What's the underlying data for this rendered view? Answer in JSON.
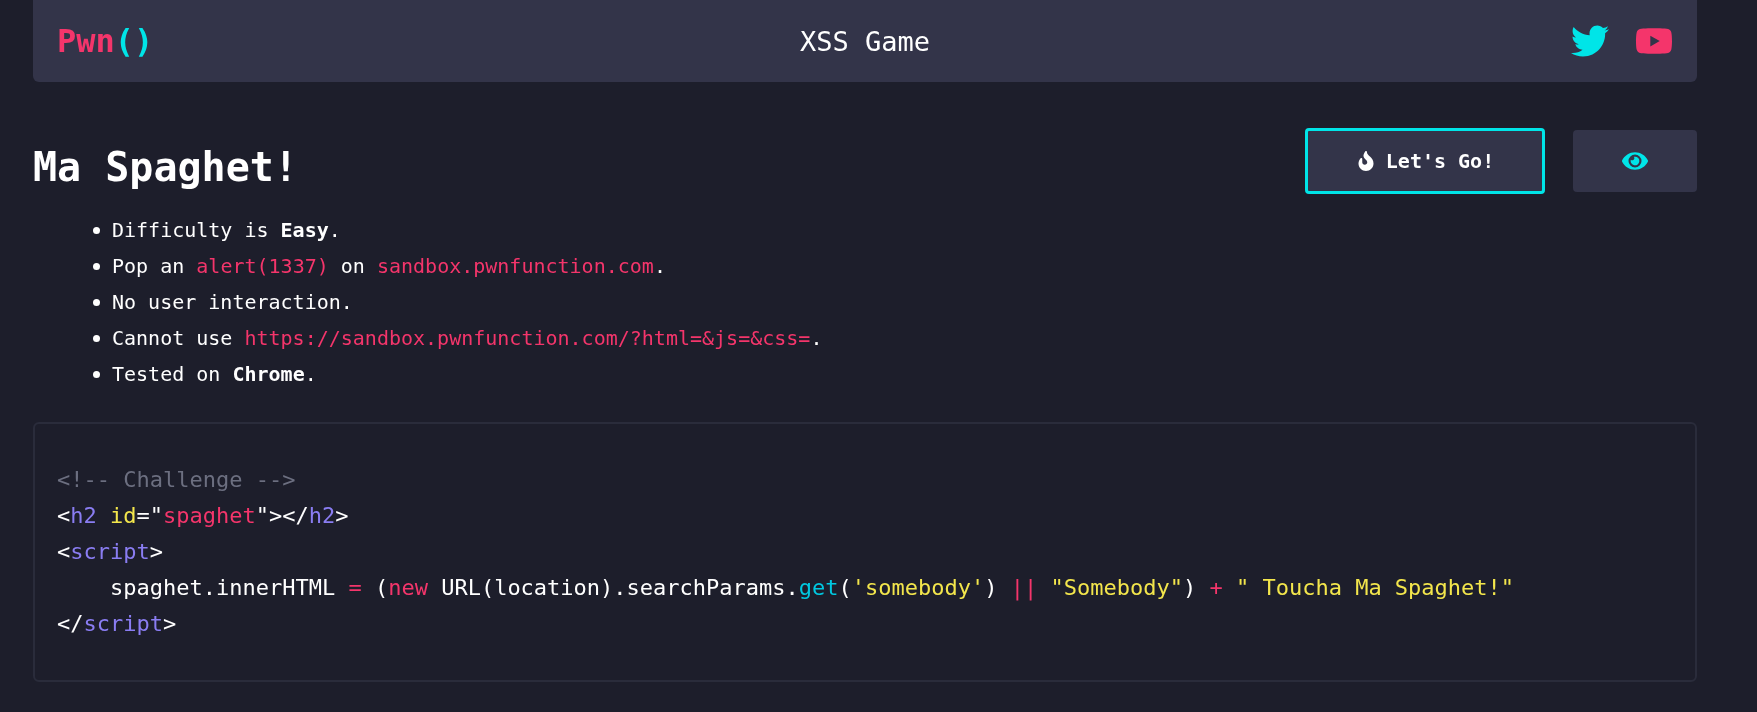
{
  "header": {
    "logo": [
      {
        "text": "Pwn",
        "kind": "word"
      },
      {
        "text": "()",
        "kind": "parens"
      }
    ],
    "title": "XSS Game",
    "links": [
      {
        "kind": "twitter"
      },
      {
        "kind": "youtube"
      }
    ]
  },
  "challenge": {
    "title": "Ma Spaghet!",
    "buttons": [
      {
        "kind": "go",
        "label": "Let's Go!"
      },
      {
        "kind": "view"
      }
    ],
    "rules": [
      [
        {
          "text": "Difficulty is ",
          "kind": "plain"
        },
        {
          "text": "Easy",
          "kind": "bold"
        },
        {
          "text": ".",
          "kind": "plain"
        }
      ],
      [
        {
          "text": "Pop an ",
          "kind": "plain"
        },
        {
          "text": "alert(1337)",
          "kind": "code"
        },
        {
          "text": " on ",
          "kind": "plain"
        },
        {
          "text": "sandbox.pwnfunction.com",
          "kind": "code"
        },
        {
          "text": ".",
          "kind": "plain"
        }
      ],
      [
        {
          "text": "No user interaction.",
          "kind": "plain"
        }
      ],
      [
        {
          "text": "Cannot use ",
          "kind": "plain"
        },
        {
          "text": "https://sandbox.pwnfunction.com/?html=&js=&css=",
          "kind": "code"
        },
        {
          "text": ".",
          "kind": "plain"
        }
      ],
      [
        {
          "text": "Tested on ",
          "kind": "plain"
        },
        {
          "text": "Chrome",
          "kind": "bold"
        },
        {
          "text": ".",
          "kind": "plain"
        }
      ]
    ]
  },
  "code": [
    [
      {
        "text": "<!-- Challenge -->",
        "kind": "comment"
      }
    ],
    [
      {
        "text": "<",
        "kind": "plain"
      },
      {
        "text": "h2",
        "kind": "tag"
      },
      {
        "text": " id",
        "kind": "attr"
      },
      {
        "text": "=\"",
        "kind": "plain"
      },
      {
        "text": "spaghet",
        "kind": "value"
      },
      {
        "text": "\"></",
        "kind": "plain"
      },
      {
        "text": "h2",
        "kind": "tag"
      },
      {
        "text": ">",
        "kind": "plain"
      }
    ],
    [
      {
        "text": "<",
        "kind": "plain"
      },
      {
        "text": "script",
        "kind": "tag"
      },
      {
        "text": ">",
        "kind": "plain"
      }
    ],
    [
      {
        "text": "    spaghet.innerHTML ",
        "kind": "plain"
      },
      {
        "text": "=",
        "kind": "operator"
      },
      {
        "text": " (",
        "kind": "plain"
      },
      {
        "text": "new",
        "kind": "operator"
      },
      {
        "text": " URL(location).searchParams.",
        "kind": "plain"
      },
      {
        "text": "get",
        "kind": "func"
      },
      {
        "text": "(",
        "kind": "plain"
      },
      {
        "text": "'somebody'",
        "kind": "string"
      },
      {
        "text": ") ",
        "kind": "plain"
      },
      {
        "text": "||",
        "kind": "operator"
      },
      {
        "text": " \"Somebody\"",
        "kind": "string"
      },
      {
        "text": ") ",
        "kind": "plain"
      },
      {
        "text": "+",
        "kind": "operator"
      },
      {
        "text": " \" Toucha Ma Spaghet!\"",
        "kind": "string"
      }
    ],
    [
      {
        "text": "</",
        "kind": "plain"
      },
      {
        "text": "script",
        "kind": "tag"
      },
      {
        "text": ">",
        "kind": "plain"
      }
    ]
  ]
}
